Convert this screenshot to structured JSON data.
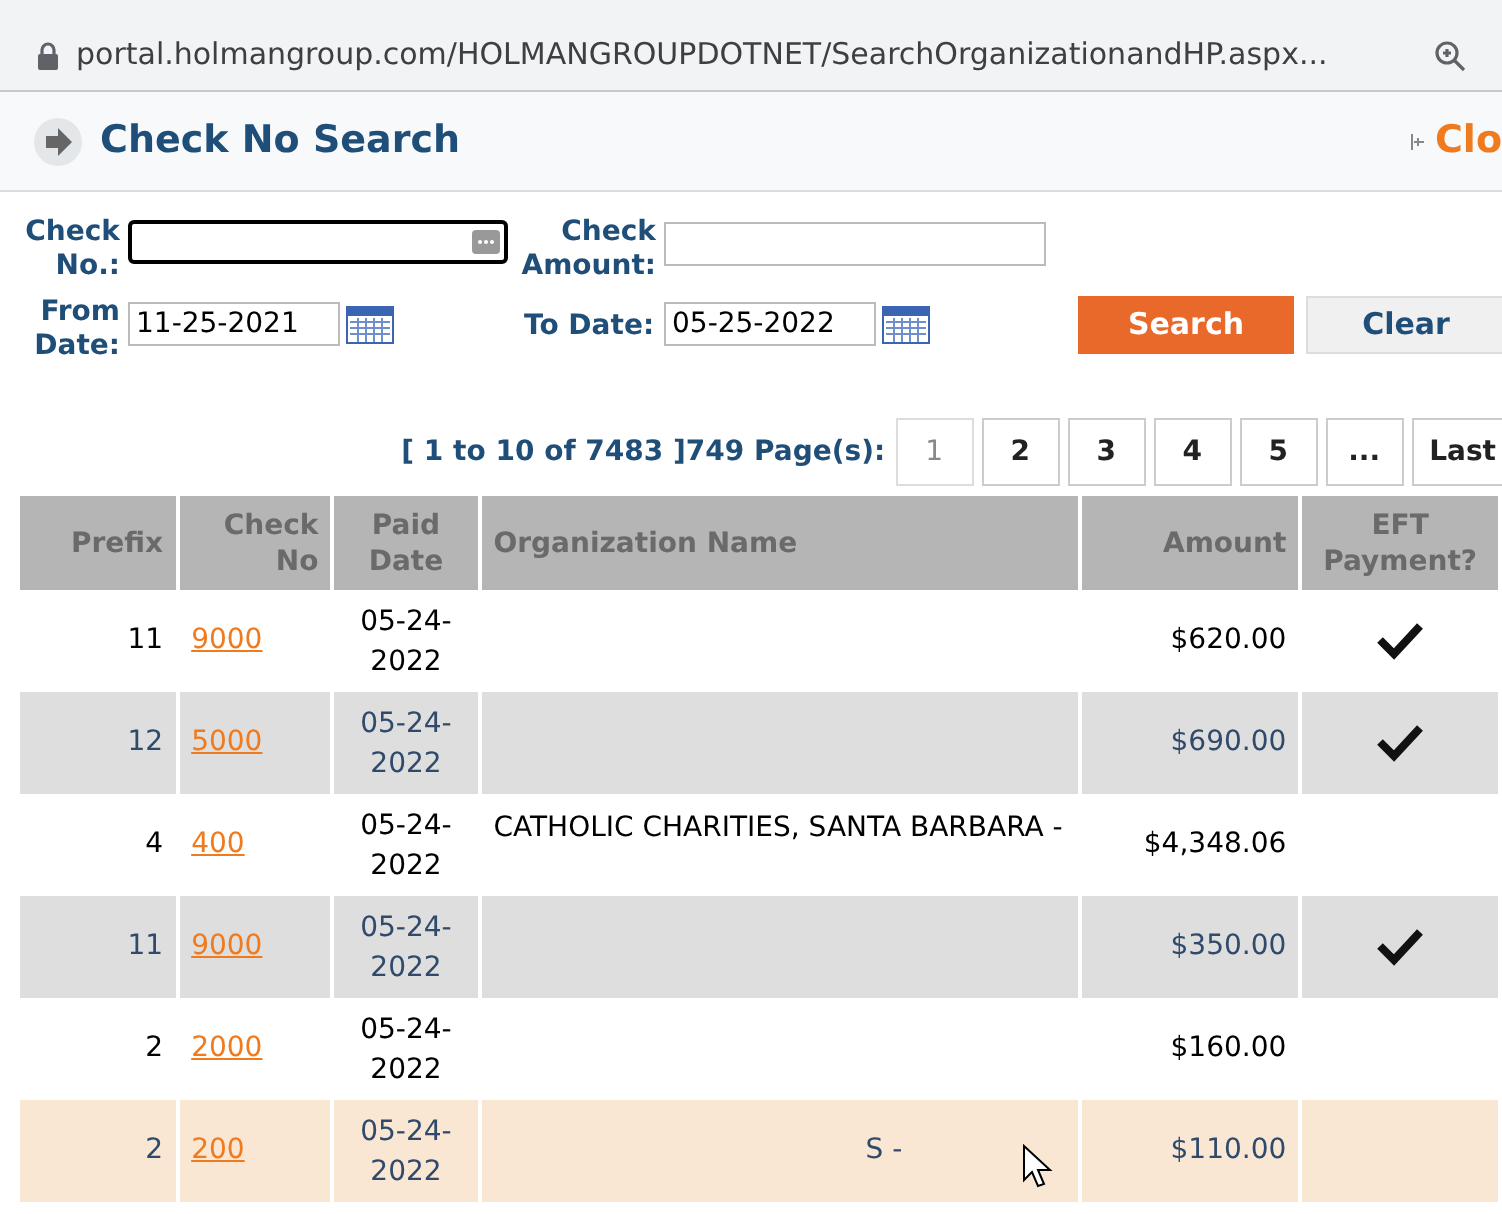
{
  "address_bar": {
    "url": "portal.holmangroup.com/HOLMANGROUPDOTNET/SearchOrganizationandHP.aspx..."
  },
  "header": {
    "title": "Check No Search",
    "close_label": "Clo"
  },
  "form": {
    "check_no_label": "Check No.:",
    "check_amount_label": "Check Amount:",
    "from_date_label": "From Date:",
    "from_date": "11-25-2021",
    "to_date_label": "To Date:",
    "to_date": "05-25-2022",
    "search_button": "Search",
    "clear_button": "Clear"
  },
  "pager": {
    "summary": "[ 1 to 10 of 7483 ]",
    "page_count": "749 Page(s):",
    "pages": [
      {
        "label": "1",
        "selected": true
      },
      {
        "label": "2",
        "selected": false
      },
      {
        "label": "3",
        "selected": false
      },
      {
        "label": "4",
        "selected": false
      },
      {
        "label": "5",
        "selected": false
      },
      {
        "label": "...",
        "selected": false
      },
      {
        "label": "Last",
        "selected": false
      }
    ]
  },
  "table": {
    "columns": [
      "Prefix",
      "Check No",
      "Paid Date",
      "Organization Name",
      "Amount",
      "EFT Payment?"
    ],
    "rows": [
      {
        "prefix": "11",
        "check_no": "9000",
        "paid_date": "05-24-2022",
        "amount": "$620.00",
        "eft": true,
        "hovered": false
      },
      {
        "prefix": "12",
        "check_no": "5000",
        "paid_date": "05-24-2022",
        "amount": "$690.00",
        "eft": true,
        "hovered": false
      },
      {
        "prefix": "4",
        "check_no": "400",
        "paid_date": "05-24-2022",
        "organization": "CATHOLIC CHARITIES, SANTA BARBARA -",
        "amount": "$4,348.06",
        "eft": false,
        "hovered": false
      },
      {
        "prefix": "11",
        "check_no": "9000",
        "paid_date": "05-24-2022",
        "amount": "$350.00",
        "eft": true,
        "hovered": false
      },
      {
        "prefix": "2",
        "check_no": "2000",
        "paid_date": "05-24-2022",
        "amount": "$160.00",
        "eft": false,
        "hovered": false
      },
      {
        "prefix": "2",
        "check_no": "200",
        "paid_date": "05-24-2022",
        "organization": "S -",
        "amount": "$110.00",
        "eft": false,
        "hovered": true
      }
    ]
  }
}
